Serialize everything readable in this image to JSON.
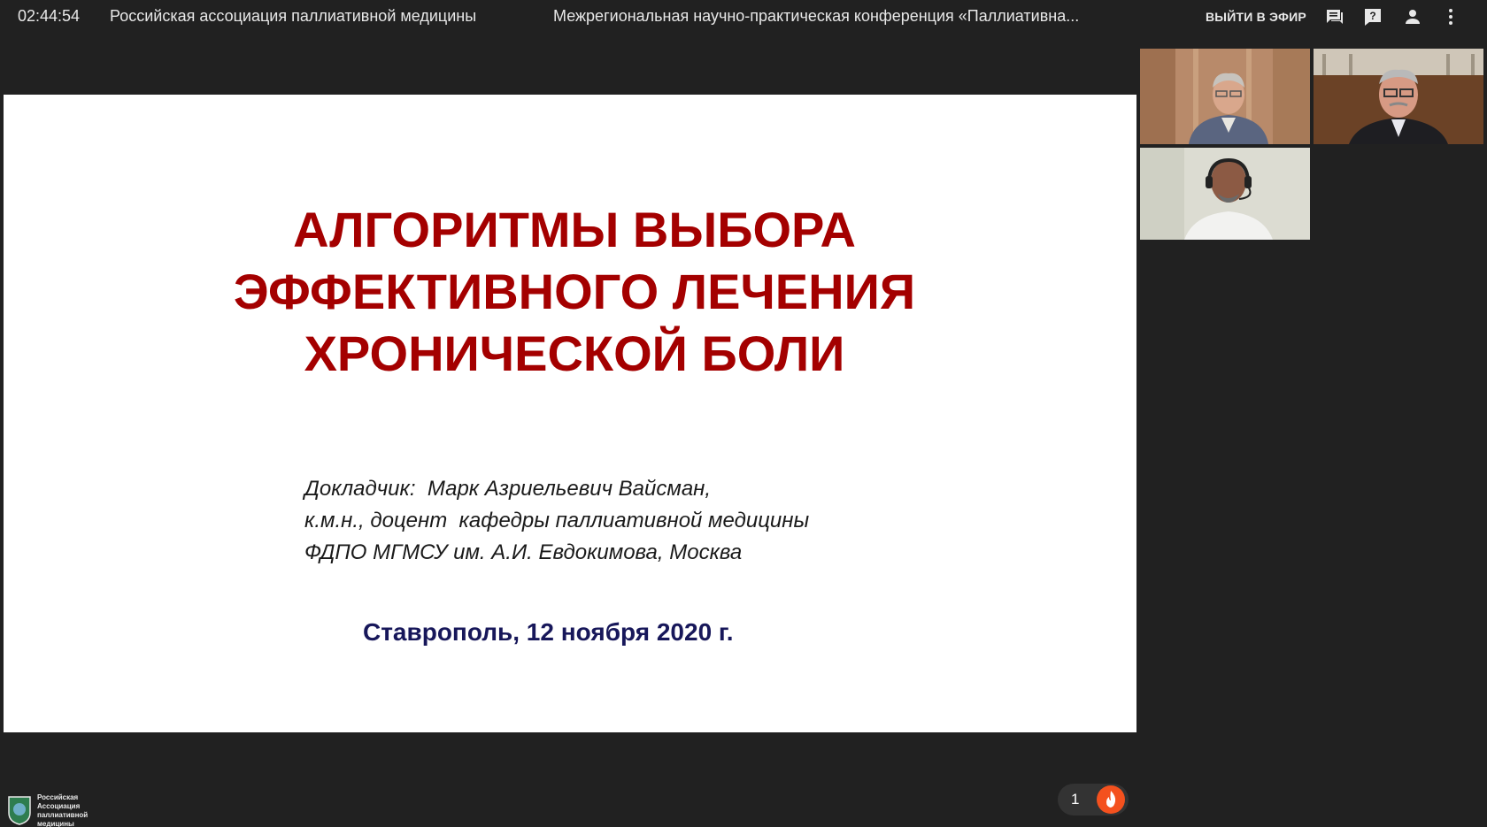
{
  "topbar": {
    "time": "02:44:54",
    "organization": "Российская ассоциация паллиативной медицины",
    "conference_title": "Межрегиональная научно-практическая конференция «Паллиативна...",
    "leave_label": "ВЫЙТИ В ЭФИР",
    "icons": [
      "chat-icon",
      "question-icon",
      "person-icon",
      "more-vert-icon"
    ]
  },
  "slide": {
    "title_lines": [
      "АЛГОРИТМЫ ВЫБОРА",
      "ЭФФЕКТИВНОГО ЛЕЧЕНИЯ",
      "ХРОНИЧЕСКОЙ БОЛИ"
    ],
    "speaker_lines": [
      "Докладчик:  Марк Азриельевич Вайсман,",
      "к.м.н., доцент  кафедры паллиативной медицины",
      "ФДПО МГМСУ им. А.И. Евдокимова, Москва"
    ],
    "place_date": "Ставрополь, 12 ноября 2020 г.",
    "colors": {
      "title": "#a40000",
      "speaker": "#1a1a1a",
      "place": "#17175a"
    }
  },
  "participants": [
    {
      "id": "participant-1"
    },
    {
      "id": "participant-2"
    },
    {
      "id": "participant-3"
    }
  ],
  "footer": {
    "logo_text": "Российская Ассоциация паллиативной медицины",
    "reaction_count": "1",
    "reaction_icon": "fire-icon",
    "accent_color": "#f4511e"
  }
}
